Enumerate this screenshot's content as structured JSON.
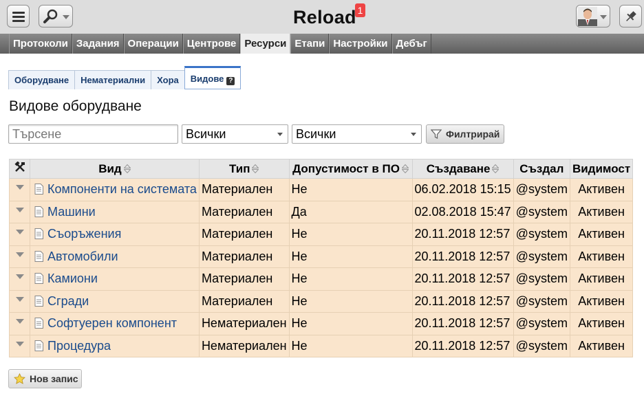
{
  "header": {
    "title": "Reload",
    "notification_count": "1"
  },
  "main_nav": [
    {
      "label": "Протоколи"
    },
    {
      "label": "Задания"
    },
    {
      "label": "Операции"
    },
    {
      "label": "Центрове"
    },
    {
      "label": "Ресурси",
      "active": true
    },
    {
      "label": "Етапи"
    },
    {
      "label": "Настройки"
    },
    {
      "label": "Дебъг"
    }
  ],
  "sub_tabs": [
    {
      "label": "Оборудване"
    },
    {
      "label": "Нематериални"
    },
    {
      "label": "Хора"
    },
    {
      "label": "Видове",
      "active": true
    }
  ],
  "page_title": "Видове оборудване",
  "filters": {
    "search_placeholder": "Търсене",
    "type_select": "Всички",
    "state_select": "Всички",
    "filter_label": "Филтрирай"
  },
  "table": {
    "columns": [
      "Вид",
      "Тип",
      "Допустимост в ПО",
      "Създаване",
      "Създал",
      "Видимост"
    ],
    "rows": [
      {
        "name": "Компоненти на системата",
        "type": "Материален",
        "admissible": "Не",
        "created": "06.02.2018 15:15",
        "creator": "@system",
        "visibility": "Активен"
      },
      {
        "name": "Машини",
        "type": "Материален",
        "admissible": "Да",
        "created": "02.08.2018 15:47",
        "creator": "@system",
        "visibility": "Активен"
      },
      {
        "name": "Съоръжения",
        "type": "Материален",
        "admissible": "Не",
        "created": "20.11.2018 12:57",
        "creator": "@system",
        "visibility": "Активен"
      },
      {
        "name": "Автомобили",
        "type": "Материален",
        "admissible": "Не",
        "created": "20.11.2018 12:57",
        "creator": "@system",
        "visibility": "Активен"
      },
      {
        "name": "Камиони",
        "type": "Материален",
        "admissible": "Не",
        "created": "20.11.2018 12:57",
        "creator": "@system",
        "visibility": "Активен"
      },
      {
        "name": "Сгради",
        "type": "Материален",
        "admissible": "Не",
        "created": "20.11.2018 12:57",
        "creator": "@system",
        "visibility": "Активен"
      },
      {
        "name": "Софтуерен компонент",
        "type": "Нематериален",
        "admissible": "Не",
        "created": "20.11.2018 12:57",
        "creator": "@system",
        "visibility": "Активен"
      },
      {
        "name": "Процедура",
        "type": "Нематериален",
        "admissible": "Не",
        "created": "20.11.2018 12:57",
        "creator": "@system",
        "visibility": "Активен"
      }
    ]
  },
  "new_record_label": "Нов запис",
  "icons": {
    "menu": "hamburger-menu-icon",
    "search": "magnifier-icon",
    "user": "user-avatar-icon",
    "pin": "pushpin-icon",
    "tools": "tools-icon",
    "sort": "sort-arrows-icon",
    "document": "document-icon",
    "funnel": "funnel-icon",
    "star": "star-icon"
  },
  "colors": {
    "row_bg": "#fae5cc",
    "link": "#1a4b8c",
    "badge": "#ee4444",
    "nav_bg": "#6f6f6f"
  }
}
